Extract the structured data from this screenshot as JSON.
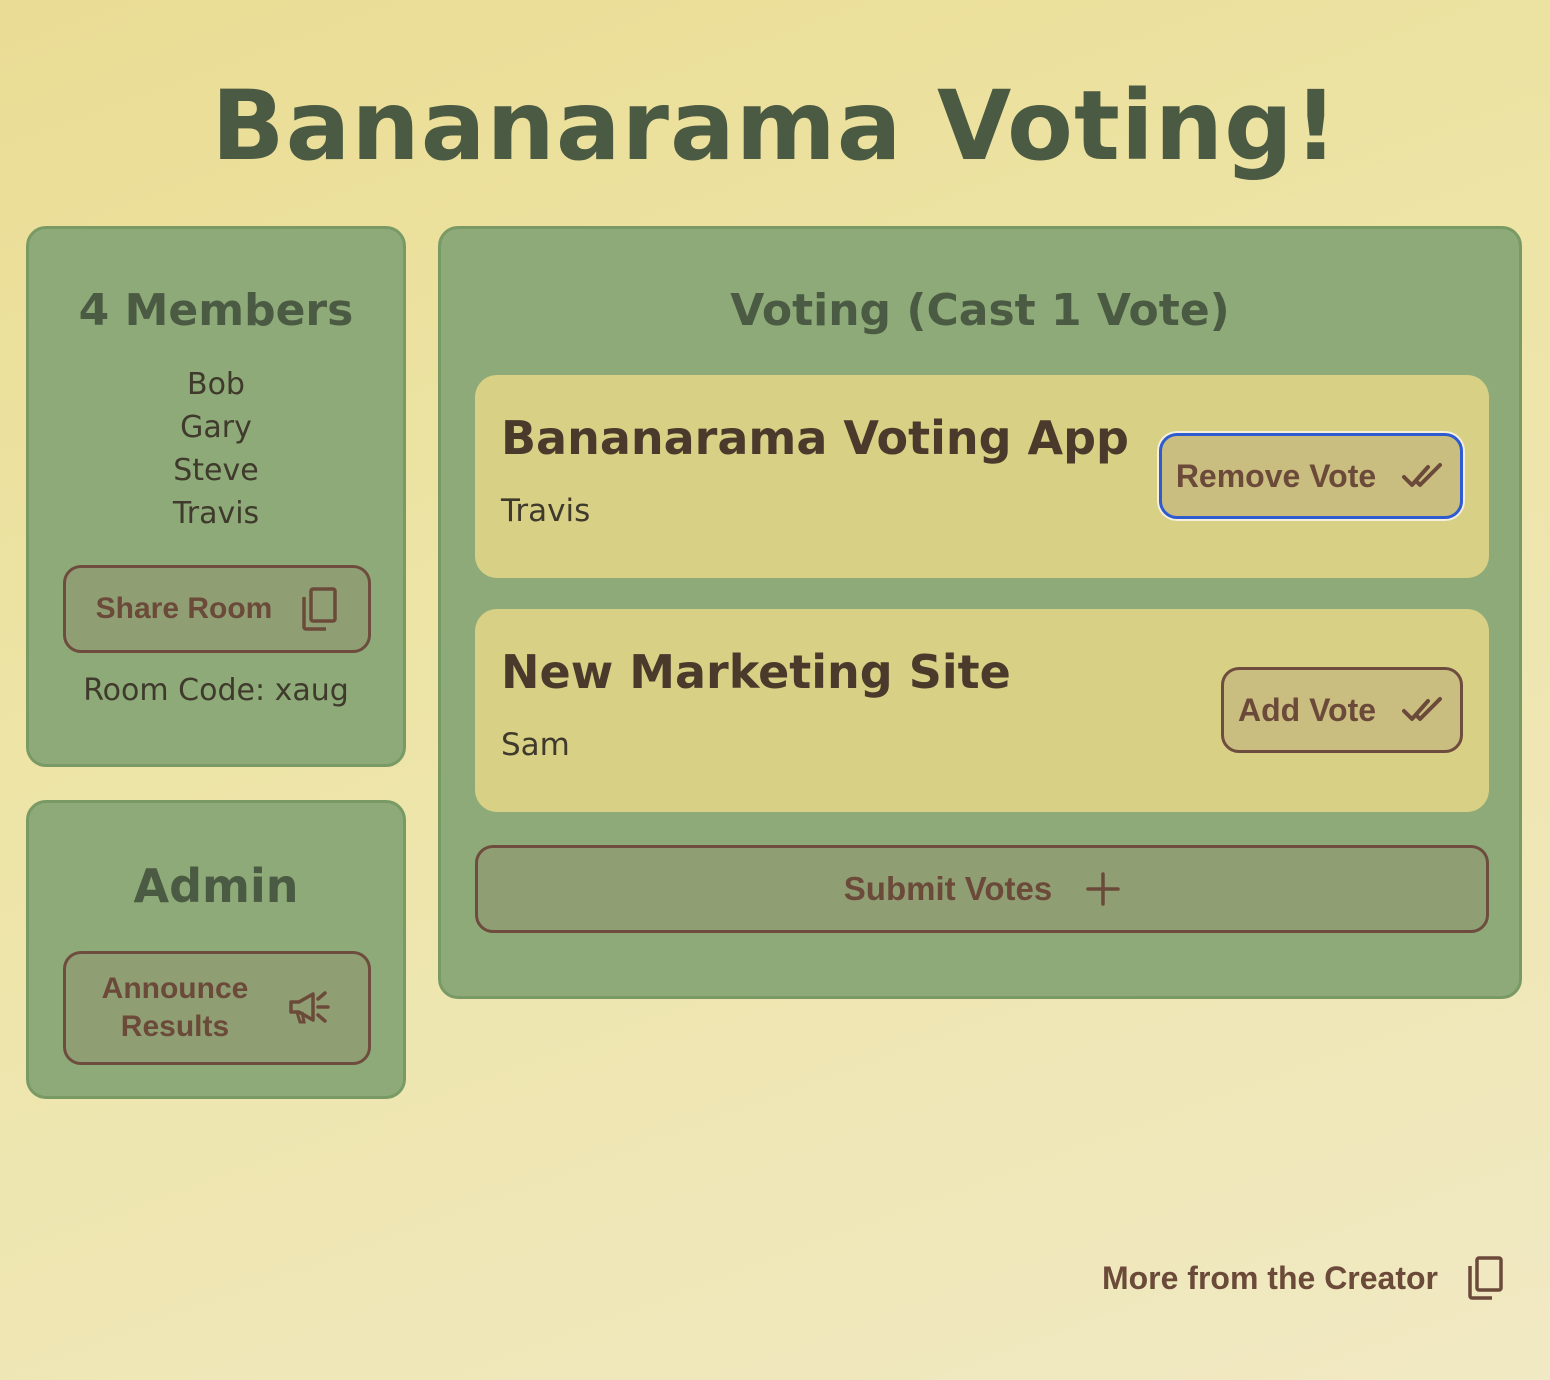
{
  "app": {
    "title": "Bananarama Voting!"
  },
  "members": {
    "heading": "4 Members",
    "names": [
      "Bob",
      "Gary",
      "Steve",
      "Travis"
    ],
    "share_label": "Share Room",
    "share_icon": "copy-icon",
    "room_code": "Room Code: xaug"
  },
  "admin": {
    "heading": "Admin",
    "announce_line1": "Announce",
    "announce_line2": "Results",
    "announce_icon": "megaphone-icon"
  },
  "voting": {
    "heading": "Voting (Cast 1 Vote)",
    "options": [
      {
        "title": "Bananarama Voting App",
        "author": "Travis",
        "button_label": "Remove Vote",
        "button_icon": "double-check-icon",
        "focused": true
      },
      {
        "title": "New Marketing Site",
        "author": "Sam",
        "button_label": "Add Vote",
        "button_icon": "double-check-icon",
        "focused": false
      }
    ],
    "submit_label": "Submit Votes",
    "submit_icon": "plus-icon"
  },
  "footer": {
    "link_label": "More from the Creator",
    "link_icon": "copy-icon"
  },
  "colors": {
    "panel": "#8daa78",
    "card": "#d8d085",
    "title_text": "#4b5a42",
    "button_text": "#6b4a3a",
    "focus_ring": "#2f5bd0"
  }
}
